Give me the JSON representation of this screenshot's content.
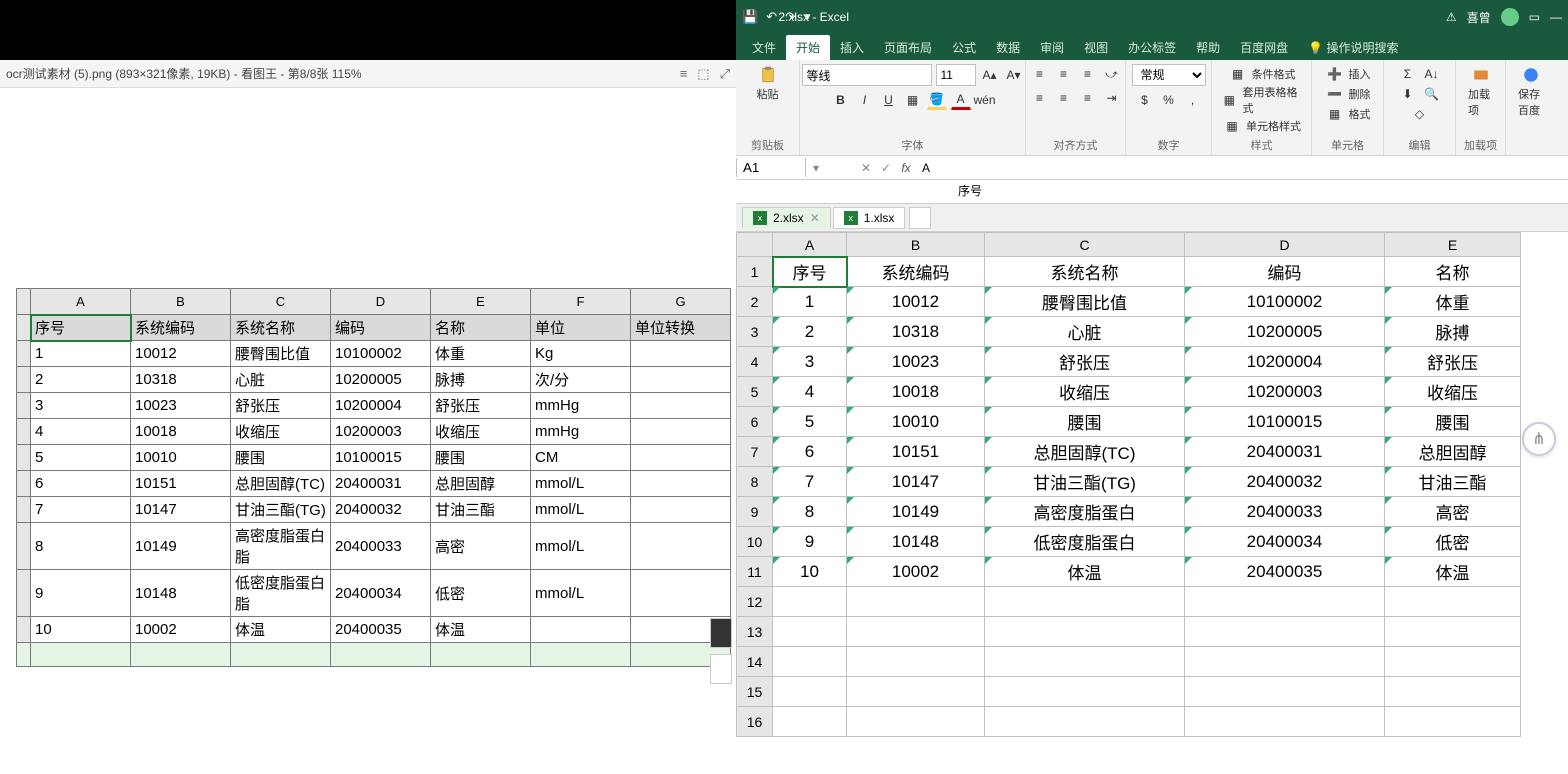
{
  "left": {
    "title": "ocr测试素材 (5).png  (893×321像素, 19KB)  -  看图王  -  第8/8张 115%",
    "icons": [
      "menu",
      "window",
      "max"
    ],
    "col_headers": [
      "A",
      "B",
      "C",
      "D",
      "E",
      "F",
      "G"
    ],
    "headers": [
      "序号",
      "系统编码",
      "系统名称",
      "编码",
      "名称",
      "单位",
      "单位转换"
    ],
    "rows": [
      [
        "1",
        "10012",
        "腰臀围比值",
        "10100002",
        "体重",
        "Kg",
        ""
      ],
      [
        "2",
        "10318",
        "心脏",
        "10200005",
        "脉搏",
        "次/分",
        ""
      ],
      [
        "3",
        "10023",
        "舒张压",
        "10200004",
        "舒张压",
        "mmHg",
        ""
      ],
      [
        "4",
        "10018",
        "收缩压",
        "10200003",
        "收缩压",
        "mmHg",
        ""
      ],
      [
        "5",
        "10010",
        "腰围",
        "10100015",
        "腰围",
        "CM",
        ""
      ],
      [
        "6",
        "10151",
        "总胆固醇(TC)",
        "20400031",
        "总胆固醇",
        "mmol/L",
        ""
      ],
      [
        "7",
        "10147",
        "甘油三酯(TG)",
        "20400032",
        "甘油三酯",
        "mmol/L",
        ""
      ],
      [
        "8",
        "10149",
        "高密度脂蛋白脂",
        "20400033",
        "高密",
        "mmol/L",
        ""
      ],
      [
        "9",
        "10148",
        "低密度脂蛋白脂",
        "20400034",
        "低密",
        "mmol/L",
        ""
      ],
      [
        "10",
        "10002",
        "体温",
        "20400035",
        "体温",
        "",
        ""
      ]
    ]
  },
  "excel": {
    "doc_title": "2.xlsx  -  Excel",
    "user_warn": "⚠",
    "user_name": "喜曾",
    "qat": [
      "💾",
      "↶",
      "↷",
      "▾"
    ],
    "win_ctl": [
      "▭",
      "—"
    ],
    "tabs": [
      "文件",
      "开始",
      "插入",
      "页面布局",
      "公式",
      "数据",
      "审阅",
      "视图",
      "办公标签",
      "帮助",
      "百度网盘"
    ],
    "active_tab": "开始",
    "tell_me": "操作说明搜索",
    "ribbon_groups": {
      "paste": "粘贴",
      "clipboard": "剪贴板",
      "font": "字体",
      "align": "对齐方式",
      "number": "数字",
      "style": "样式",
      "cell": "单元格",
      "edit": "编辑",
      "addin": "加载项",
      "baidu": "保存百度"
    },
    "font": {
      "name": "等线",
      "size": "11"
    },
    "number_fmt": "常规",
    "style_btns": [
      "条件格式",
      "套用表格格式",
      "单元格样式"
    ],
    "cell_btns": [
      "插入",
      "删除",
      "格式"
    ],
    "addin_btn": "加载项",
    "name_box": "A1",
    "formula": {
      "A": "A",
      "value": "序号"
    },
    "sheets": [
      {
        "name": "2.xlsx",
        "active": true
      },
      {
        "name": "1.xlsx",
        "active": false
      }
    ],
    "columns": [
      "A",
      "B",
      "C",
      "D",
      "E"
    ],
    "header_row": [
      "A",
      "B",
      "C",
      "D",
      "E"
    ],
    "data_header": [
      "序号",
      "系统编码",
      "系统名称",
      "编码",
      "名称"
    ],
    "data": [
      [
        "1",
        "10012",
        "腰臀围比值",
        "10100002",
        "体重"
      ],
      [
        "2",
        "10318",
        "心脏",
        "10200005",
        "脉搏"
      ],
      [
        "3",
        "10023",
        "舒张压",
        "10200004",
        "舒张压"
      ],
      [
        "4",
        "10018",
        "收缩压",
        "10200003",
        "收缩压"
      ],
      [
        "5",
        "10010",
        "腰围",
        "10100015",
        "腰围"
      ],
      [
        "6",
        "10151",
        "总胆固醇(TC)",
        "20400031",
        "总胆固醇"
      ],
      [
        "7",
        "10147",
        "甘油三酯(TG)",
        "20400032",
        "甘油三酯"
      ],
      [
        "8",
        "10149",
        "高密度脂蛋白",
        "20400033",
        "高密"
      ],
      [
        "9",
        "10148",
        "低密度脂蛋白",
        "20400034",
        "低密"
      ],
      [
        "10",
        "10002",
        "体温",
        "20400035",
        "体温"
      ]
    ],
    "row_numbers_max": 16
  }
}
